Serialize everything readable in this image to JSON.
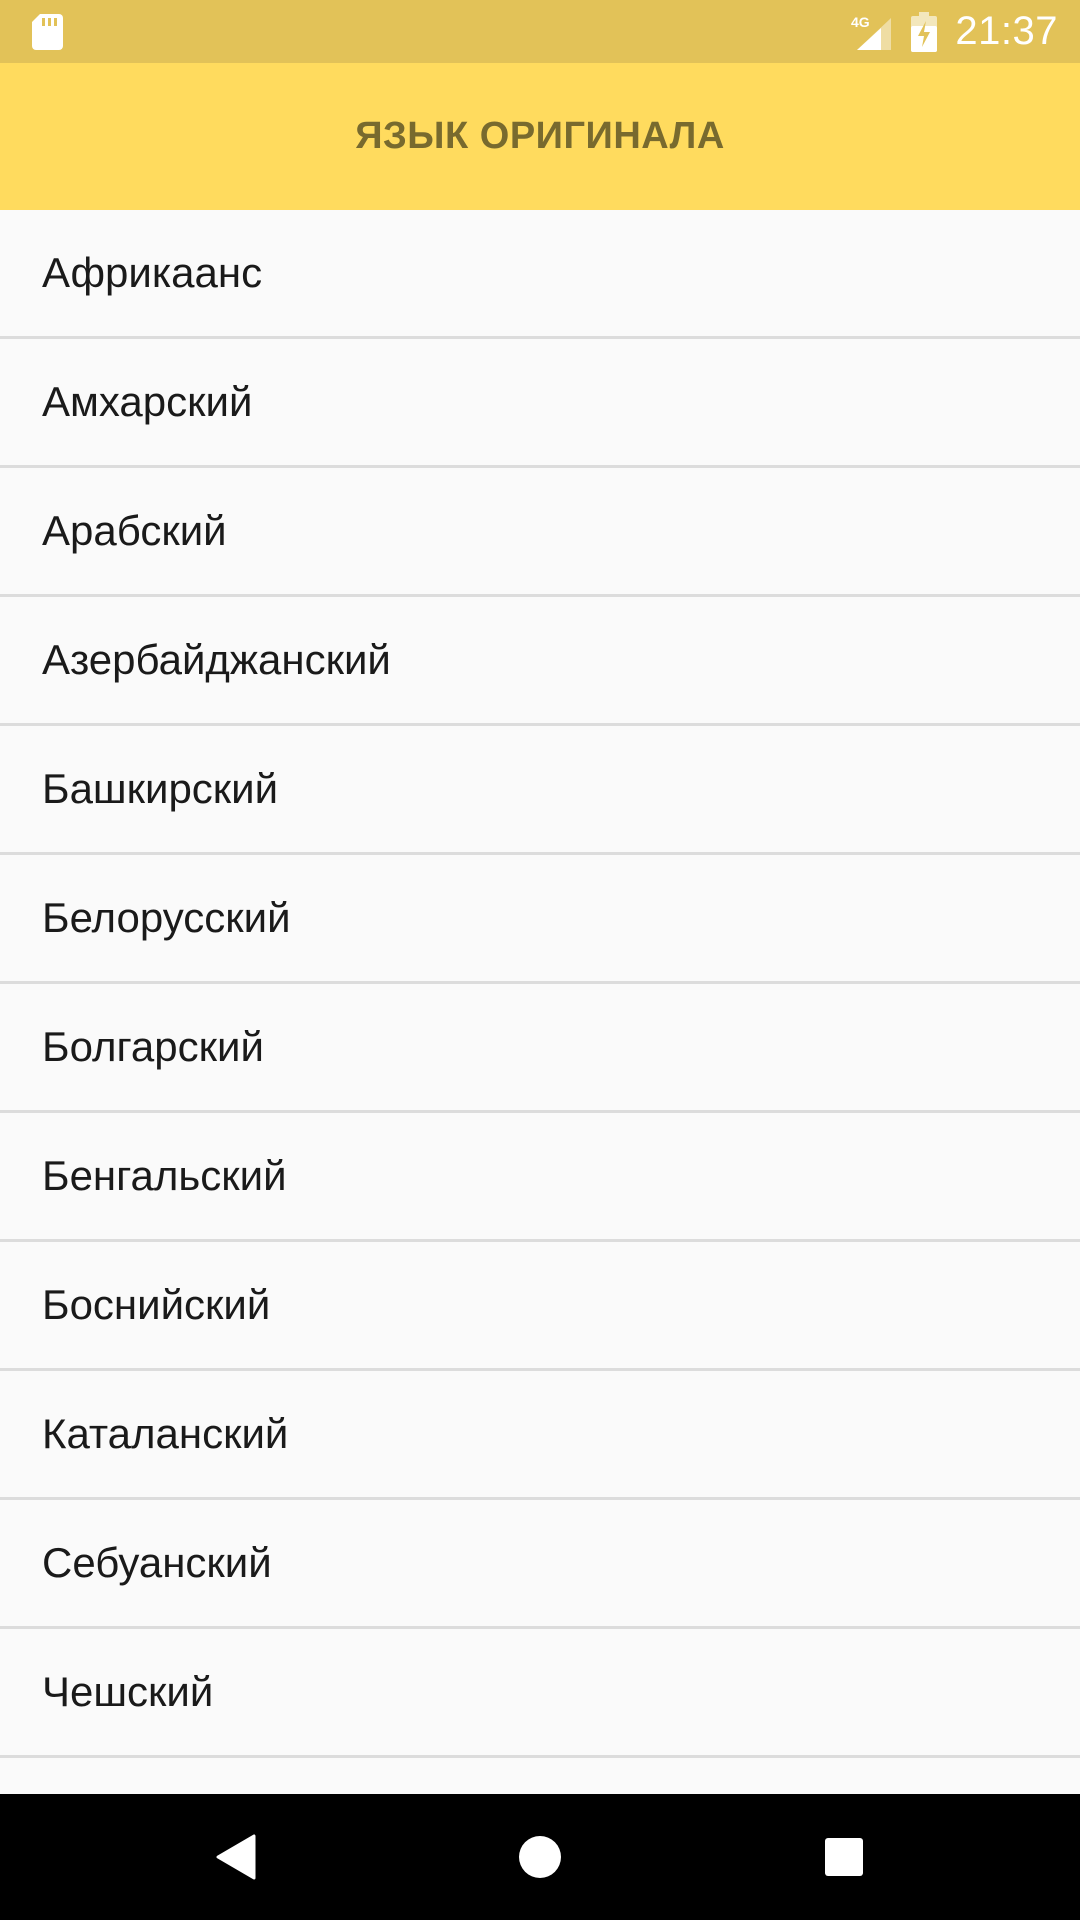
{
  "status_bar": {
    "time": "21:37",
    "network_label": "4G",
    "icons": [
      "sd-card-icon",
      "signal-4g-icon",
      "battery-charging-icon"
    ]
  },
  "app_bar": {
    "title": "ЯЗЫК ОРИГИНАЛА"
  },
  "languages": [
    "Африкаанс",
    "Амхарский",
    "Арабский",
    "Азербайджанский",
    "Башкирский",
    "Белорусский",
    "Болгарский",
    "Бенгальский",
    "Боснийский",
    "Каталанский",
    "Себуанский",
    "Чешский",
    ""
  ],
  "nav_bar": {
    "icons": [
      "back-icon",
      "home-icon",
      "recents-icon"
    ]
  },
  "colors": {
    "status_bar": "#e2c258",
    "app_bar": "#ffdb5e",
    "title_text": "#786a2e",
    "list_background": "#fafafa",
    "divider": "#dcdcdc",
    "nav_bar": "#000000"
  }
}
